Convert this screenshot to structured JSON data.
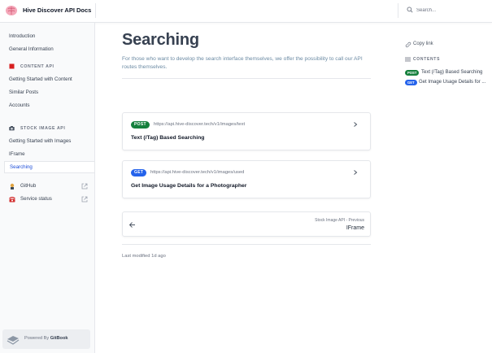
{
  "header": {
    "site_title": "Hive Discover API Docs",
    "search_placeholder": "Search...",
    "logo_icon": "brain-icon"
  },
  "sidebar": {
    "top_items": [
      {
        "label": "Introduction"
      },
      {
        "label": "General Information"
      }
    ],
    "groups": [
      {
        "title": "CONTENT API",
        "icon": "red-square-icon",
        "items": [
          {
            "label": "Getting Started with Content"
          },
          {
            "label": "Similar Posts"
          },
          {
            "label": "Accounts"
          }
        ]
      },
      {
        "title": "STOCK IMAGE API",
        "icon": "camera-icon",
        "items": [
          {
            "label": "Getting Started with Images"
          },
          {
            "label": "IFrame"
          },
          {
            "label": "Searching",
            "active": true
          }
        ]
      }
    ],
    "external_links": [
      {
        "label": "GitHub",
        "icon": "octocat-icon"
      },
      {
        "label": "Service status",
        "icon": "telephone-icon"
      }
    ],
    "powered_by": {
      "prefix": "Powered By",
      "brand": "GitBook"
    }
  },
  "main": {
    "title": "Searching",
    "description": "For those who want to develop the search interface themselves, we offer the possibility to call our API routes themselves.",
    "cards": [
      {
        "method": "POST",
        "url": "https://api.hive-discover.tech/v1/images/text",
        "title": "Text (/Tag) Based Searching"
      },
      {
        "method": "GET",
        "url": "https://api.hive-discover.tech/v1/images/used",
        "title": "Get Image Usage Details for a Photographer"
      }
    ],
    "previous": {
      "breadcrumb": "Stock Image API - Previous",
      "title": "IFrame"
    },
    "last_modified": "Last modified 1d ago"
  },
  "right_panel": {
    "copy_link": "Copy link",
    "contents_heading": "CONTENTS",
    "toc": [
      {
        "method": "POST",
        "label": "Text (/Tag) Based Searching"
      },
      {
        "method": "GET",
        "label": "Get Image Usage Details for ..."
      }
    ]
  },
  "colors": {
    "post": "#15803d",
    "get": "#2563eb",
    "active_link": "#1d4ed8",
    "description": "#6b8aa3"
  }
}
